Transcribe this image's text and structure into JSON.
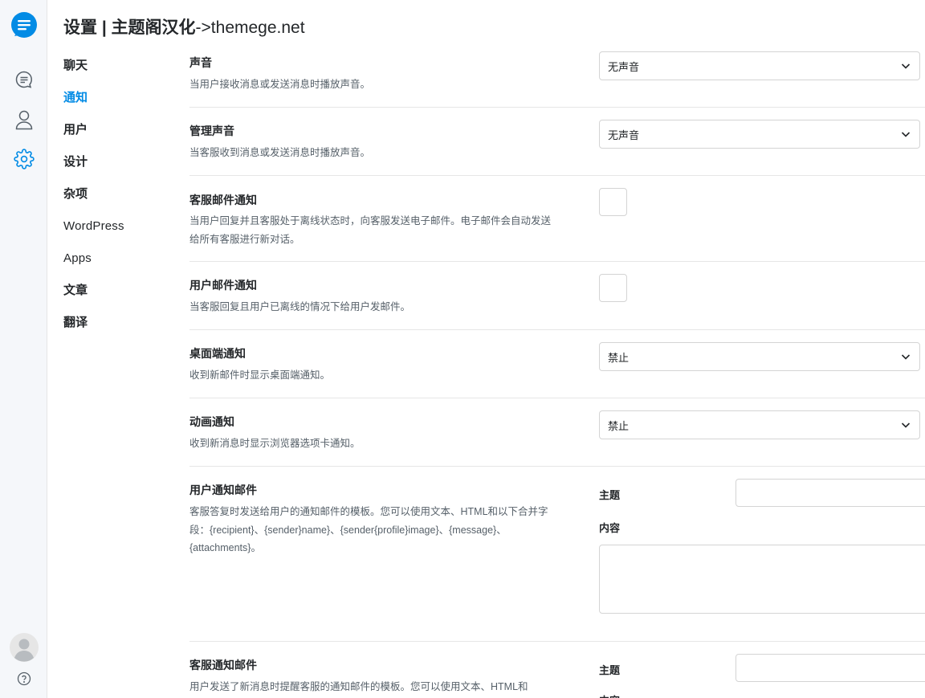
{
  "header": {
    "title": "设置 | 主题阁汉化",
    "title_suffix": "->themege.net"
  },
  "rail": {
    "icons": [
      "logo-icon",
      "chat-icon",
      "user-icon",
      "settings-icon",
      "avatar-icon",
      "help-icon"
    ],
    "accent": "#028be5"
  },
  "nav": {
    "items": [
      {
        "label": "聊天"
      },
      {
        "label": "通知"
      },
      {
        "label": "用户"
      },
      {
        "label": "设计"
      },
      {
        "label": "杂项"
      },
      {
        "label": "WordPress"
      },
      {
        "label": "Apps"
      },
      {
        "label": "文章"
      },
      {
        "label": "翻译"
      }
    ],
    "active": "通知"
  },
  "settings": {
    "sound": {
      "label": "声音",
      "description": "当用户接收消息或发送消息时播放声音。",
      "value": "无声音"
    },
    "admin_sound": {
      "label": "管理声音",
      "description": "当客服收到消息或发送消息时播放声音。",
      "value": "无声音"
    },
    "agent_email": {
      "label": "客服邮件通知",
      "description": "当用户回复并且客服处于离线状态时，向客服发送电子邮件。电子邮件会自动发送给所有客服进行新对话。",
      "checked": false
    },
    "user_email": {
      "label": "用户邮件通知",
      "description": "当客服回复且用户已离线的情况下给用户发邮件。",
      "checked": false
    },
    "desktop": {
      "label": "桌面端通知",
      "description": "收到新邮件时显示桌面端通知。",
      "value": "禁止"
    },
    "animation": {
      "label": "动画通知",
      "description": "收到新消息时显示浏览器选项卡通知。",
      "value": "禁止"
    },
    "user_template": {
      "label": "用户通知邮件",
      "description": "客服答复时发送给用户的通知邮件的模板。您可以使用文本、HTML和以下合并字段：{recipient}、{sender}name}、{sender{profile}image}、{message}、{attachments}。",
      "subject_label": "主题",
      "subject_value": "",
      "content_label": "内容",
      "content_value": ""
    },
    "agent_template": {
      "label": "客服通知邮件",
      "description": "用户发送了新消息时提醒客服的通知邮件的模板。您可以使用文本、HTML和",
      "subject_label": "主题",
      "subject_value": "",
      "content_label": "内容"
    }
  }
}
